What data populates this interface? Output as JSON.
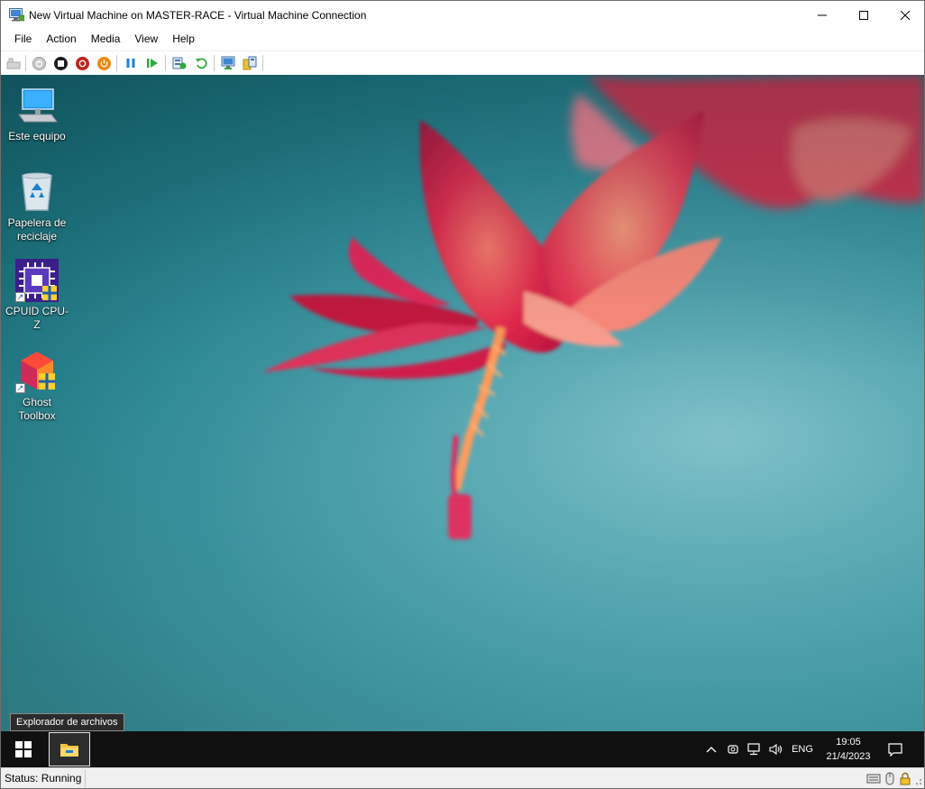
{
  "window": {
    "title": "New Virtual Machine on MASTER-RACE - Virtual Machine Connection"
  },
  "menu": {
    "items": [
      "File",
      "Action",
      "Media",
      "View",
      "Help"
    ]
  },
  "toolbar": {
    "icons": [
      "ctrl-alt-del-icon",
      "start-icon",
      "turn-off-icon",
      "shut-down-icon",
      "save-icon",
      "pause-icon",
      "resume-icon",
      "checkpoint-icon",
      "revert-icon",
      "enhanced-session-icon",
      "share-icon"
    ]
  },
  "desktop": {
    "icons": [
      {
        "label": "Este equipo"
      },
      {
        "label": "Papelera de reciclaje"
      },
      {
        "label": "CPUID CPU-Z"
      },
      {
        "label": "Ghost Toolbox"
      }
    ],
    "tooltip": "Explorador de archivos"
  },
  "taskbar": {
    "language": "ENG",
    "time": "19:05",
    "date": "21/4/2023"
  },
  "statusbar": {
    "status": "Status: Running"
  }
}
